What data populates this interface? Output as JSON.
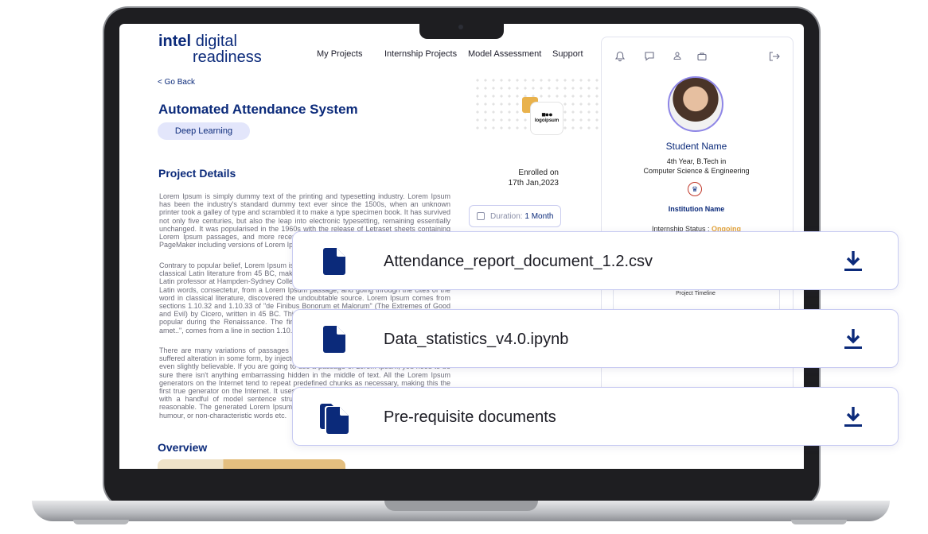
{
  "brand": {
    "part1": "intel",
    "part2": "digital",
    "part3": "readiness"
  },
  "nav": [
    {
      "label": "My Projects"
    },
    {
      "label": "Internship Projects"
    },
    {
      "label": "Model Assessment"
    },
    {
      "label": "Support"
    }
  ],
  "back_label": "< Go Back",
  "project": {
    "title": "Automated Attendance System",
    "tag": "Deep Learning",
    "logo_text": "logoipsum",
    "details_heading": "Project Details",
    "enrolled_label": "Enrolled on",
    "enrolled_date": "17th Jan,2023",
    "duration_label": "Duration:",
    "duration_value": "1 Month",
    "paragraphs": [
      "Lorem Ipsum is simply dummy text of the printing and typesetting industry. Lorem Ipsum has been the industry's standard dummy text ever since the 1500s, when an unknown printer took a galley of type and scrambled it to make a type specimen book. It has survived not only five centuries, but also the leap into electronic typesetting, remaining essentially unchanged. It was popularised in the 1960s with the release of Letraset sheets containing Lorem Ipsum passages, and more recently with desktop publishing software like Aldus PageMaker including versions of Lorem Ipsum.",
      "Contrary to popular belief, Lorem Ipsum is not simply random text. It has roots in a piece of classical Latin literature from 45 BC, making it over 2000 years old. Richard McClintock, a Latin professor at Hampden-Sydney College in Virginia, looked up one of the more obscure Latin words, consectetur, from a Lorem Ipsum passage, and going through the cites of the word in classical literature, discovered the undoubtable source. Lorem Ipsum comes from sections 1.10.32 and 1.10.33 of \"de Finibus Bonorum et Malorum\" (The Extremes of Good and Evil) by Cicero, written in 45 BC. This book is a treatise on the theory of ethics, very popular during the Renaissance. The first line of Lorem Ipsum, \"Lorem ipsum dolor sit amet..\", comes from a line in section 1.10.32.",
      "There are many variations of passages of Lorem Ipsum available, but the majority have suffered alteration in some form, by injected humour, or randomised words which don't look even slightly believable. If you are going to use a passage of Lorem Ipsum, you need to be sure there isn't anything embarrassing hidden in the middle of text. All the Lorem Ipsum generators on the Internet tend to repeat predefined chunks as necessary, making this the first true generator on the Internet. It uses a dictionary of over 200 Latin words, combined with a handful of model sentence structures, to generate Lorem Ipsum which looks reasonable. The generated Lorem Ipsum is therefore always free from repetition, injected humour, or non-characteristic words etc."
    ],
    "overview_heading": "Overview"
  },
  "student": {
    "name": "Student Name",
    "year": "4th Year, B.Tech in",
    "course": "Computer Science & Engineering",
    "institution": "Institution Name",
    "status_label": "Internship Status :",
    "status_value": "Ongoing",
    "timeline_label": "Project Timeline"
  },
  "panel_icons": [
    "bell-icon",
    "chat-icon",
    "user-icon",
    "briefcase-icon",
    "logout-icon"
  ],
  "files": [
    {
      "name": "Attendance_report_document_1.2.csv",
      "icon": "file-icon"
    },
    {
      "name": "Data_statistics_v4.0.ipynb",
      "icon": "file-icon"
    },
    {
      "name": "Pre-requisite documents",
      "icon": "files-stack-icon"
    }
  ],
  "colors": {
    "brand": "#0b2a7a",
    "accent": "#e3a43a",
    "card_border": "#c8cbf2",
    "tag_bg": "#e3e6fb"
  }
}
